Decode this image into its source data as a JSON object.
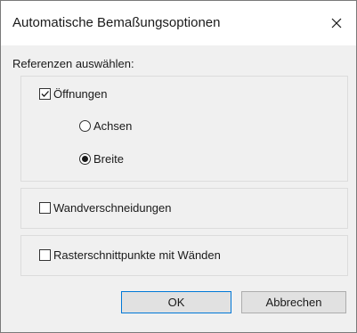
{
  "dialog": {
    "title": "Automatische Bemaßungsoptionen",
    "section_label": "Referenzen auswählen:",
    "openings": {
      "label": "Öffnungen",
      "checked": true,
      "options": [
        {
          "label": "Achsen",
          "selected": false
        },
        {
          "label": "Breite",
          "selected": true
        }
      ]
    },
    "wall_intersections": {
      "label": "Wandverschneidungen",
      "checked": false
    },
    "grid_intersections": {
      "label": "Rasterschnittpunkte mit Wänden",
      "checked": false
    },
    "buttons": {
      "ok": "OK",
      "cancel": "Abbrechen"
    }
  },
  "icons": {
    "close": "close-icon",
    "check": "checkmark-icon"
  }
}
